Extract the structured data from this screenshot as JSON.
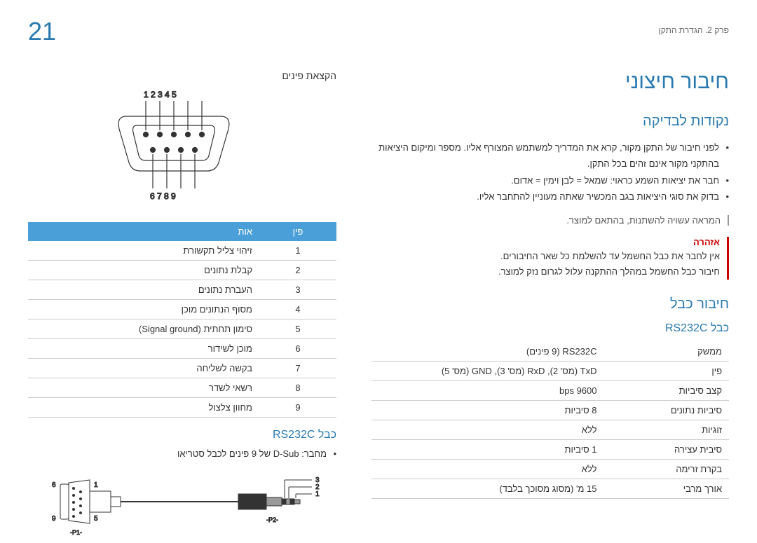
{
  "page_number": "21",
  "chapter": "פרק 2. הגדרת התקן",
  "main_title": "חיבור חיצוני",
  "checkpoints": {
    "title": "נקודות לבדיקה",
    "bullets": [
      "לפני חיבור של התקן מקור, קרא את המדריך למשתמש המצורף אליו.\nמספר ומיקום היציאות בהתקני מקור אינם זהים בכל התקן.",
      "חבר את יציאות השמע כראוי: שמאל = לבן וימין = אדום.",
      "בדוק את סוגי היציאות בגב המכשיר שאתה מעוניין להתחבר אליו."
    ],
    "note": "המראה עשויה להשתנות, בהתאם למוצר."
  },
  "warning": {
    "title": "אזהרה",
    "lines": [
      "אין לחבר את כבל החשמל עד להשלמת כל שאר החיבורים.",
      "חיבור כבל החשמל במהלך ההתקנה עלול לגרום נזק למוצר."
    ]
  },
  "cable_connection": {
    "title": "חיבור כבל",
    "subtitle": "כבל RS232C",
    "spec": [
      {
        "k": "ממשק",
        "v": "RS232C (9 פינים)"
      },
      {
        "k": "פין",
        "v": "TxD (מס' 2), RxD (מס' 3), GND (מס' 5)"
      },
      {
        "k": "קצב סיביות",
        "v": "9600 bps"
      },
      {
        "k": "סיביות נתונים",
        "v": "8 סיביות"
      },
      {
        "k": "זוגיות",
        "v": "ללא"
      },
      {
        "k": "סיבית עצירה",
        "v": "1 סיביות"
      },
      {
        "k": "בקרת זרימה",
        "v": "ללא"
      },
      {
        "k": "אורך מרבי",
        "v": "15 מ' (מסוג מסוכך בלבד)"
      }
    ]
  },
  "pin_assignment": {
    "title": "הקצאת פינים",
    "top_labels": [
      "1",
      "2",
      "3",
      "4",
      "5"
    ],
    "bottom_labels": [
      "6",
      "7",
      "8",
      "9"
    ],
    "header_pin": "פין",
    "header_signal": "אות",
    "rows": [
      {
        "n": "1",
        "s": "זיהוי צליל תקשורת"
      },
      {
        "n": "2",
        "s": "קבלת נתונים"
      },
      {
        "n": "3",
        "s": "העברת נתונים"
      },
      {
        "n": "4",
        "s": "מסוף הנתונים מוכן"
      },
      {
        "n": "5",
        "s": "סימון תחתית (Signal ground)"
      },
      {
        "n": "6",
        "s": "מוכן לשידור"
      },
      {
        "n": "7",
        "s": "בקשה לשליחה"
      },
      {
        "n": "8",
        "s": "רשאי לשדר"
      },
      {
        "n": "9",
        "s": "מחוון צלצול"
      }
    ]
  },
  "cable_section": {
    "title": "כבל RS232C",
    "connector_note": "מחבר: D-Sub של 9 פינים לכבל סטריאו",
    "left_labels": {
      "t": "6",
      "b": "9",
      "r_t": "1",
      "r_b": "5",
      "tag": "-P1-"
    },
    "right_labels": {
      "l1": "3",
      "l2": "2",
      "l3": "1",
      "tag": "-P2-"
    }
  }
}
